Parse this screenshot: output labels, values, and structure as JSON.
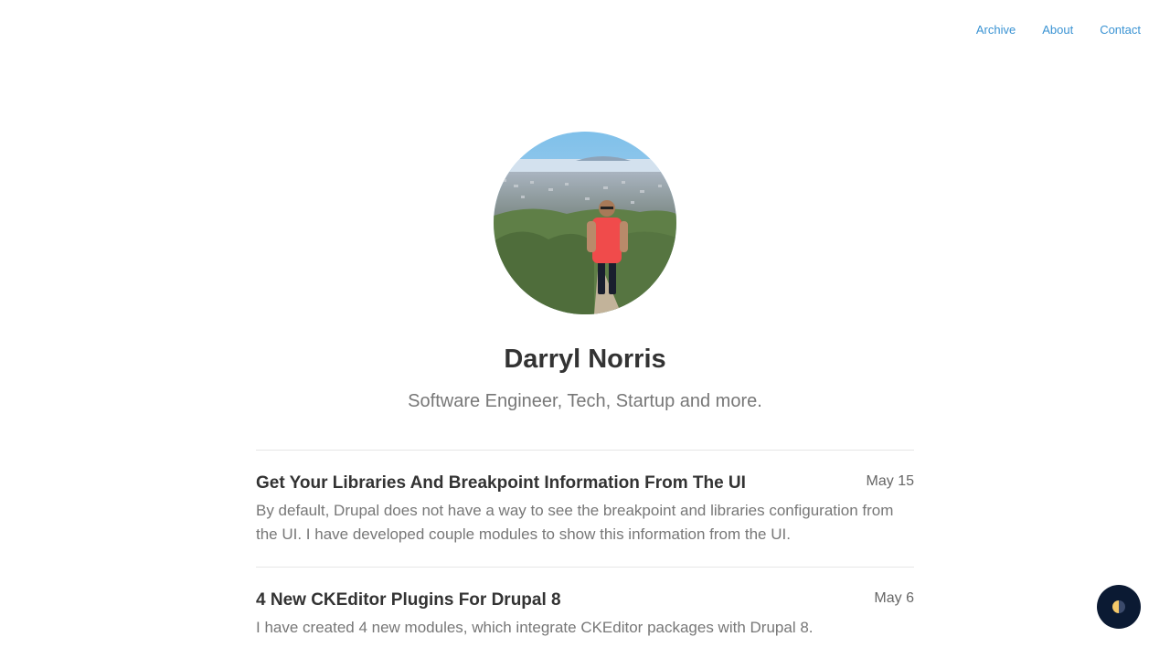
{
  "nav": {
    "items": [
      {
        "label": "Archive"
      },
      {
        "label": "About"
      },
      {
        "label": "Contact"
      }
    ]
  },
  "profile": {
    "name": "Darryl Norris",
    "tagline": "Software Engineer, Tech, Startup and more."
  },
  "posts": [
    {
      "title": "Get Your Libraries And Breakpoint Information From The UI",
      "date": "May 15",
      "excerpt": "By default, Drupal does not have a way to see the breakpoint and libraries configuration from the UI. I have developed couple modules to show this information from the UI."
    },
    {
      "title": "4 New CKEditor Plugins For Drupal 8",
      "date": "May 6",
      "excerpt": "I have created 4 new modules, which integrate CKEditor packages with Drupal 8."
    }
  ],
  "theme_toggle": {
    "icon": "half-moon-icon",
    "colors": {
      "background": "#0b1a33",
      "light": "#f5c96a",
      "dark": "#1f2a44"
    }
  },
  "colors": {
    "link": "#3a93d3",
    "heading": "#333333",
    "muted": "#777777",
    "divider": "#e6e6e6"
  }
}
